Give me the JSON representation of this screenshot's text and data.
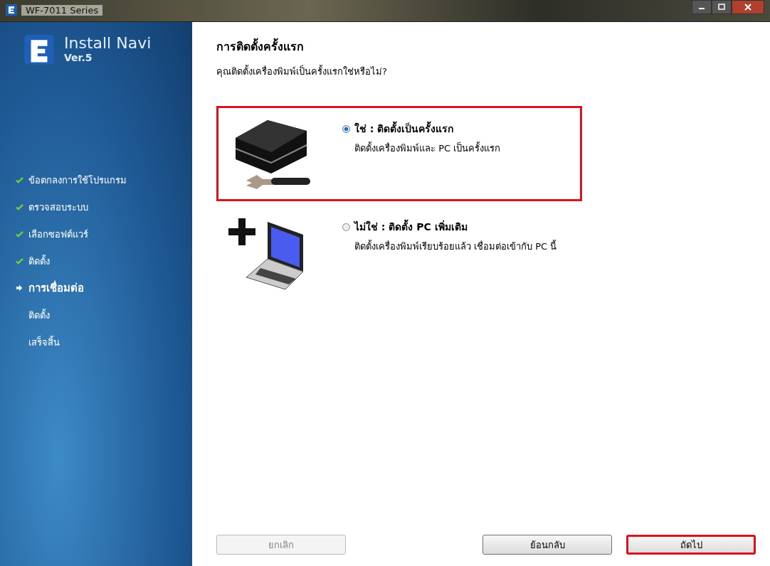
{
  "window": {
    "title": "WF-7011 Series"
  },
  "sidebar": {
    "app_name": "Install Navi",
    "version": "Ver.5",
    "steps": [
      {
        "label": "ข้อตกลงการใช้โปรแกรม",
        "kind": "done"
      },
      {
        "label": "ตรวจสอบระบบ",
        "kind": "done"
      },
      {
        "label": "เลือกซอฟต์แวร์",
        "kind": "done"
      },
      {
        "label": "ติดตั้ง",
        "kind": "done"
      },
      {
        "label": "การเชื่อมต่อ",
        "kind": "current"
      },
      {
        "label": "ติดตั้ง",
        "kind": "pending"
      },
      {
        "label": "เสร็จสิ้น",
        "kind": "pending"
      }
    ]
  },
  "heading": "การติดตั้งครั้งแรก",
  "question": "คุณติดตั้งเครื่องพิมพ์เป็นครั้งแรกใช่หรือไม่?",
  "options": [
    {
      "kind": "printer",
      "label": "ใช่ : ติดตั้งเป็นครั้งแรก",
      "description": "ติดตั้งเครื่องพิมพ์และ PC เป็นครั้งแรก",
      "selected": true,
      "highlighted": true
    },
    {
      "kind": "laptop",
      "label": "ไม่ใช่ : ติดตั้ง PC เพิ่มเติม",
      "description": "ติดตั้งเครื่องพิมพ์เรียบร้อยแล้ว เชื่อมต่อเข้ากับ PC นี้",
      "selected": false,
      "highlighted": false
    }
  ],
  "buttons": [
    {
      "label": "ยกเลิก",
      "disabled": true,
      "highlighted": false
    },
    {
      "label": "ย้อนกลับ",
      "disabled": false,
      "highlighted": false
    },
    {
      "label": "ถัดไป",
      "disabled": false,
      "highlighted": true
    }
  ]
}
